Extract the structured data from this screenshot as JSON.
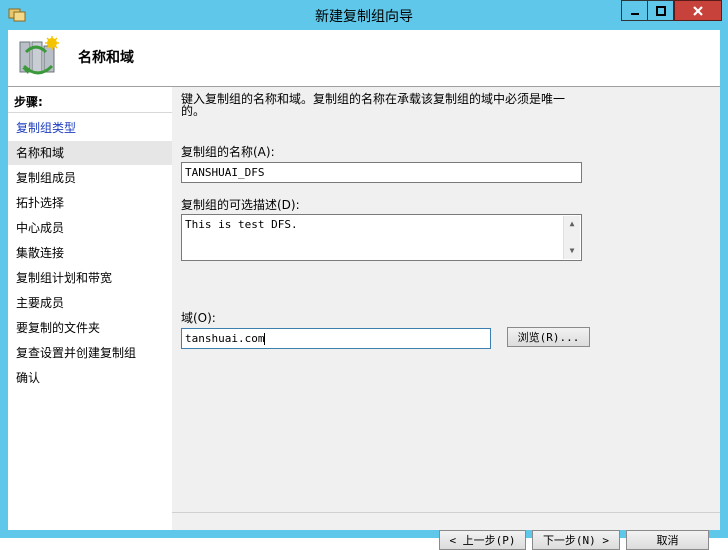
{
  "window": {
    "title": "新建复制组向导",
    "controls": {
      "minimize": "—",
      "maximize": "□",
      "close": "✕"
    }
  },
  "header": {
    "title": "名称和域",
    "icon": "replication-wizard-icon"
  },
  "sidebar": {
    "steps_title": "步骤:",
    "steps": [
      {
        "label": "复制组类型",
        "state": "link"
      },
      {
        "label": "名称和域",
        "state": "current"
      },
      {
        "label": "复制组成员",
        "state": "normal"
      },
      {
        "label": "拓扑选择",
        "state": "normal"
      },
      {
        "label": "中心成员",
        "state": "normal"
      },
      {
        "label": "集散连接",
        "state": "normal"
      },
      {
        "label": "复制组计划和带宽",
        "state": "normal"
      },
      {
        "label": "主要成员",
        "state": "normal"
      },
      {
        "label": "要复制的文件夹",
        "state": "normal"
      },
      {
        "label": "复查设置并创建复制组",
        "state": "normal"
      },
      {
        "label": "确认",
        "state": "normal"
      }
    ]
  },
  "main": {
    "description": "键入复制组的名称和域。复制组的名称在承载该复制组的域中必须是唯一的。",
    "name_label": "复制组的名称(A):",
    "name_value": "TANSHUAI_DFS",
    "desc_label": "复制组的可选描述(D):",
    "desc_value": "This is test DFS.",
    "domain_label": "域(O):",
    "domain_value": "tanshuai.com",
    "browse_label": "浏览(R)..."
  },
  "footer": {
    "prev_label": "< 上一步(P)",
    "next_label": "下一步(N) >",
    "cancel_label": "取消"
  }
}
